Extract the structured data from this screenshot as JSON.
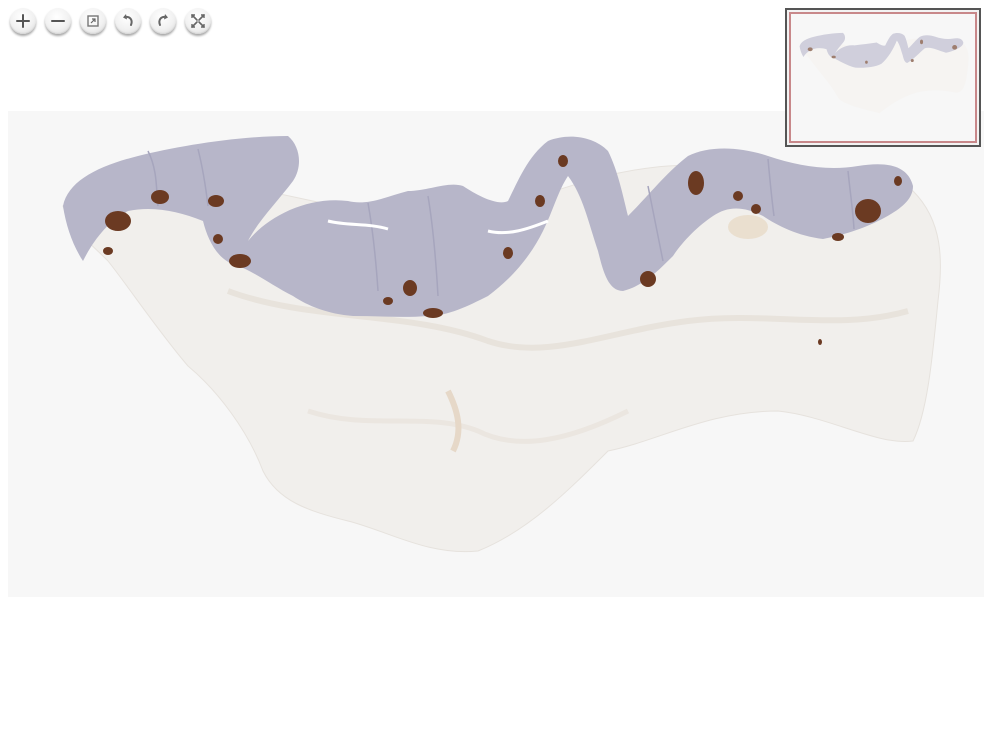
{
  "toolbar": {
    "buttons": [
      {
        "name": "zoom-in",
        "icon": "plus-icon"
      },
      {
        "name": "zoom-out",
        "icon": "minus-icon"
      },
      {
        "name": "home",
        "icon": "home-fit-icon"
      },
      {
        "name": "rotate-left",
        "icon": "rotate-left-icon"
      },
      {
        "name": "rotate-right",
        "icon": "rotate-right-icon"
      },
      {
        "name": "full-page",
        "icon": "fullscreen-icon"
      }
    ]
  },
  "viewer": {
    "background": "#f7f7f7",
    "tissue_color": "#f1efec",
    "mucosa_color": "#b7b6c9",
    "stain_color": "#6b3a22"
  },
  "navigator": {
    "border_color": "#555555",
    "region_color": "#c8888a"
  }
}
